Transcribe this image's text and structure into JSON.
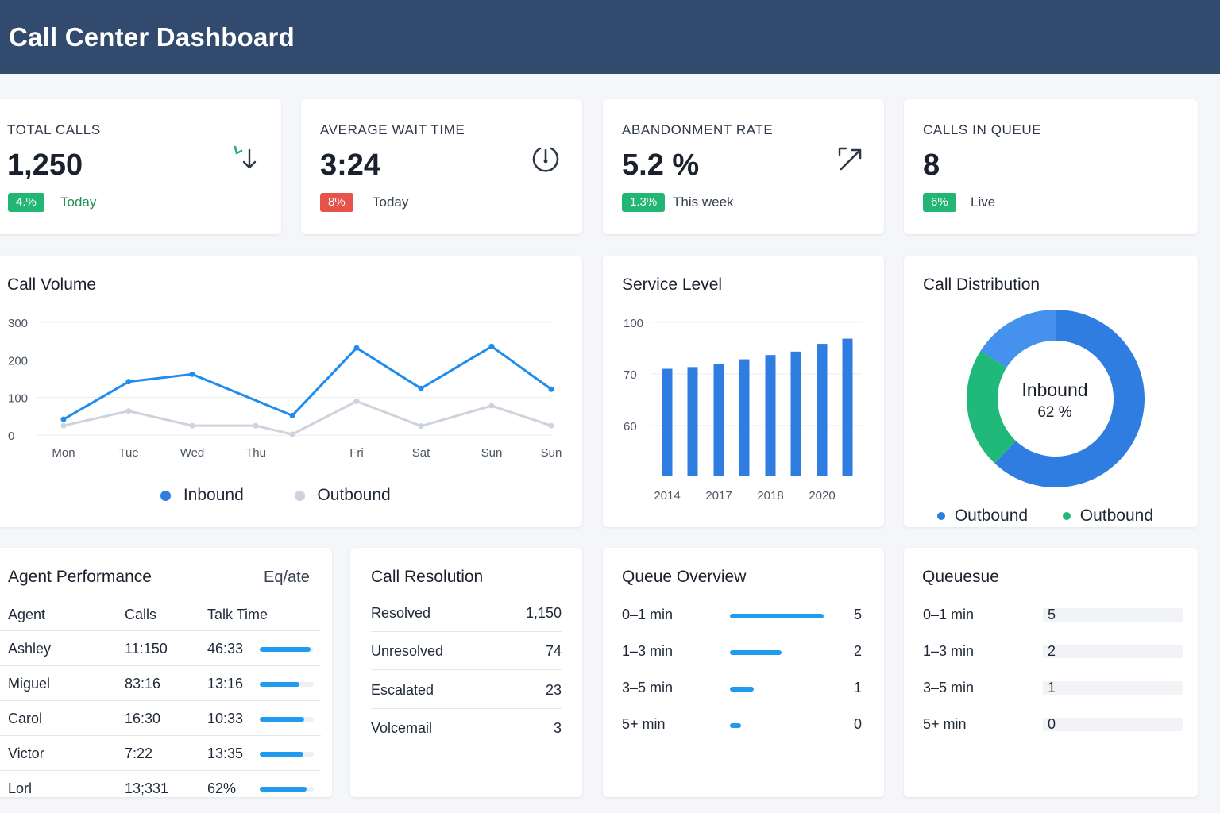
{
  "header": {
    "title": "Call Center Dashboard"
  },
  "kpis": [
    {
      "title": "TOTAL CALLS",
      "value": "1,250",
      "badge": "4.%",
      "badge_color": "#22b573",
      "period": "Today",
      "period_color": "#1e8e4e",
      "icon": "trend-down-icon"
    },
    {
      "title": "AVERAGE WAIT TIME",
      "value": "3:24",
      "badge": "8%",
      "badge_color": "#e5534b",
      "period": "Today",
      "period_color": "#374151",
      "icon": "timer-icon"
    },
    {
      "title": "ABANDONMENT RATE",
      "value": "5.2 %",
      "badge": "1.3%",
      "badge_color": "#22b573",
      "period": "This week",
      "period_color": "#374151",
      "icon": "trend-up-icon"
    },
    {
      "title": "CALLS IN QUEUE",
      "value": "8",
      "badge": "6%",
      "badge_color": "#22b573",
      "period": "Live",
      "period_color": "#374151",
      "icon": ""
    }
  ],
  "call_volume": {
    "title": "Call Volume",
    "legend": [
      "Inbound",
      "Outbound"
    ]
  },
  "service_level": {
    "title": "Service Level"
  },
  "call_distribution": {
    "title": "Call Distribution",
    "center_label": "Inbound",
    "center_value": "62 %",
    "legend": [
      "Outbound",
      "Outbound"
    ]
  },
  "chart_data": [
    {
      "type": "line",
      "title": "Call Volume",
      "categories": [
        "Mon",
        "Tue",
        "Wed",
        "Thu",
        "",
        "Fri",
        "Sat",
        "Sun",
        "Sun"
      ],
      "yticks": [
        0,
        100,
        200,
        300
      ],
      "ylim": [
        0,
        300
      ],
      "grid": true,
      "legend_position": "bottom",
      "series": [
        {
          "name": "Inbound",
          "color": "#1f8ded",
          "values": [
            42,
            142,
            162,
            null,
            52,
            232,
            124,
            236,
            122
          ]
        },
        {
          "name": "Outbound",
          "color": "#ccd3dc",
          "values": [
            25,
            64,
            25,
            25,
            2,
            90,
            24,
            78,
            25
          ]
        }
      ]
    },
    {
      "type": "bar",
      "title": "Service Level",
      "xticks": [
        "2014",
        "2017",
        "2018",
        "2020"
      ],
      "yticks": [
        60,
        70,
        100
      ],
      "grid": true,
      "color": "#2f7de0",
      "values": [
        73,
        74,
        76,
        78.5,
        81,
        83,
        87.5,
        90.5
      ]
    },
    {
      "type": "pie",
      "title": "Call Distribution",
      "legend_position": "bottom",
      "slices": [
        {
          "value": 62,
          "color": "#2f7de0"
        },
        {
          "value": 22,
          "color": "#20b97a"
        },
        {
          "value": 16,
          "color": "#4592ee"
        }
      ]
    }
  ],
  "agent_performance": {
    "title": "Agent Performance",
    "action": "Eq/ate",
    "columns": [
      "Agent",
      "Calls",
      "Talk Time"
    ],
    "rows": [
      {
        "agent": "Ashley",
        "calls": "11:150",
        "talk": "46:33",
        "bar": 1.0
      },
      {
        "agent": "Miguel",
        "calls": "83:16",
        "talk": "13:16",
        "bar": 0.78
      },
      {
        "agent": "Carol",
        "calls": "16:30",
        "talk": "10:33",
        "bar": 0.88
      },
      {
        "agent": "Victor",
        "calls": "7:22",
        "talk": "13:35",
        "bar": 0.86
      },
      {
        "agent": "Lorl",
        "calls": "13;331",
        "talk": "62%",
        "bar": 0.92
      }
    ]
  },
  "call_resolution": {
    "title": "Call Resolution",
    "rows": [
      {
        "label": "Resolved",
        "value": "1,150"
      },
      {
        "label": "Unresolved",
        "value": "74"
      },
      {
        "label": "Escalated",
        "value": "23"
      },
      {
        "label": "Volcemail",
        "value": "3"
      }
    ]
  },
  "queue_overview": {
    "title": "Queue Overview",
    "rows": [
      {
        "label": "0–1 min",
        "value": "5",
        "bar": 1.0
      },
      {
        "label": "1–3 min",
        "value": "2",
        "bar": 0.55
      },
      {
        "label": "3–5 min",
        "value": "1",
        "bar": 0.25
      },
      {
        "label": "5+ min",
        "value": "0",
        "bar": 0.12
      }
    ]
  },
  "queuesue": {
    "title": "Queuesue",
    "rows": [
      {
        "label": "0–1 min",
        "value": "5"
      },
      {
        "label": "1–3 min",
        "value": "2"
      },
      {
        "label": "3–5 min",
        "value": "1"
      },
      {
        "label": "5+ min",
        "value": "0"
      }
    ]
  }
}
